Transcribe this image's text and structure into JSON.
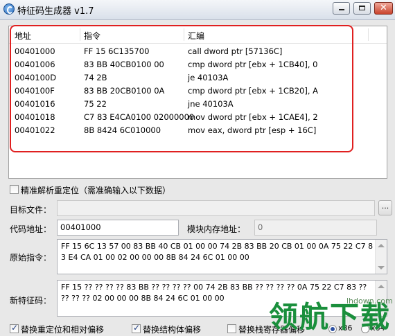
{
  "window": {
    "title": "特征码生成器 v1.7"
  },
  "list": {
    "columns": [
      "地址",
      "指令",
      "汇编"
    ],
    "rows": [
      [
        "00401000",
        "FF 15 6C135700",
        "call dword ptr [57136C]"
      ],
      [
        "00401006",
        "83 BB 40CB0100 00",
        "cmp dword ptr [ebx + 1CB40], 0"
      ],
      [
        "0040100D",
        "74 2B",
        "je 40103A"
      ],
      [
        "0040100F",
        "83 BB 20CB0100 0A",
        "cmp dword ptr [ebx + 1CB20], A"
      ],
      [
        "00401016",
        "75 22",
        "jne 40103A"
      ],
      [
        "00401018",
        "C7 83 E4CA0100 02000000",
        "mov dword ptr [ebx + 1CAE4], 2"
      ],
      [
        "00401022",
        "8B 8424 6C010000",
        "mov eax, dword ptr [esp + 16C]"
      ]
    ]
  },
  "precise_relocation": {
    "label": "精准解析重定位（需准确输入以下数据）",
    "checked": false
  },
  "target_file": {
    "label": "目标文件：",
    "value": "",
    "browse_label": "..."
  },
  "code_address": {
    "label": "代码地址：",
    "value": "00401000"
  },
  "module_base": {
    "label": "模块内存地址：",
    "value": "0"
  },
  "original": {
    "label": "原始指令：",
    "value": "FF 15 6C 13 57 00 83 BB 40 CB 01 00 00 74 2B 83 BB 20 CB 01 00 0A 75 22 C7 83 E4 CA 01 00 02 00 00 00 8B 84 24 6C 01 00 00"
  },
  "signature": {
    "label": "新特征码：",
    "value": "FF 15 ?? ?? ?? ?? 83 BB ?? ?? ?? ?? 00 74 2B 83 BB ?? ?? ?? ?? 0A 75 22 C7 83 ?? ?? ?? ?? 02 00 00 00 8B 84 24 6C 01 00 00"
  },
  "options": [
    {
      "label": "替换重定位和相对偏移",
      "checked": true
    },
    {
      "label": "替换结构体偏移",
      "checked": true
    },
    {
      "label": "替换栈寄存器偏移",
      "checked": false
    }
  ],
  "arch": {
    "x86": "x86",
    "x64": "x64"
  },
  "watermark": {
    "text": "领航下载",
    "url": "lhdown.com"
  }
}
